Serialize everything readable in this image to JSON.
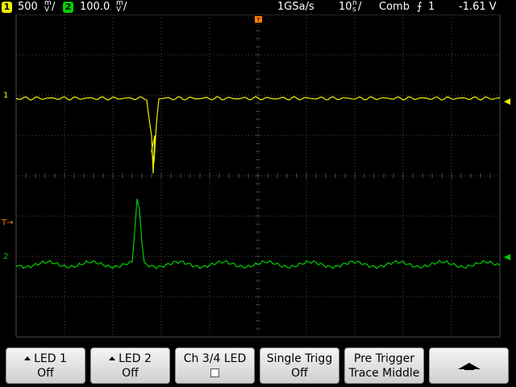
{
  "status_bar": {
    "ch1": {
      "badge": "1",
      "scale": "500",
      "unit_top": "m",
      "unit_bottom": "V",
      "color": "#f0f000"
    },
    "ch2": {
      "badge": "2",
      "scale": "100.0",
      "unit_top": "m",
      "unit_bottom": "V",
      "color": "#00d000"
    },
    "sample_rate": "1GSa/s",
    "timebase": "10",
    "timebase_unit_top": "n",
    "timebase_unit_bottom": "s",
    "acq_mode": "Comb",
    "trigger_channel": "1",
    "trigger_level": "-1.61 V"
  },
  "markers": {
    "ch1_ground": "1",
    "ch2_ground": "2",
    "trigger_level": "T"
  },
  "colors": {
    "ch1": "#f0f000",
    "ch2": "#00d000",
    "grid": "#4a4a4a",
    "trigger_marker": "#ff8000"
  },
  "softkeys": [
    {
      "line1": "LED 1",
      "line2": "Off"
    },
    {
      "line1": "LED 2",
      "line2": "Off"
    },
    {
      "line1": "Ch 3/4 LED",
      "line2": ""
    },
    {
      "line1": "Single Trigg",
      "line2": "Off"
    },
    {
      "line1": "Pre Trigger",
      "line2": "Trace Middle"
    },
    {
      "line1": "",
      "line2": ""
    }
  ]
}
